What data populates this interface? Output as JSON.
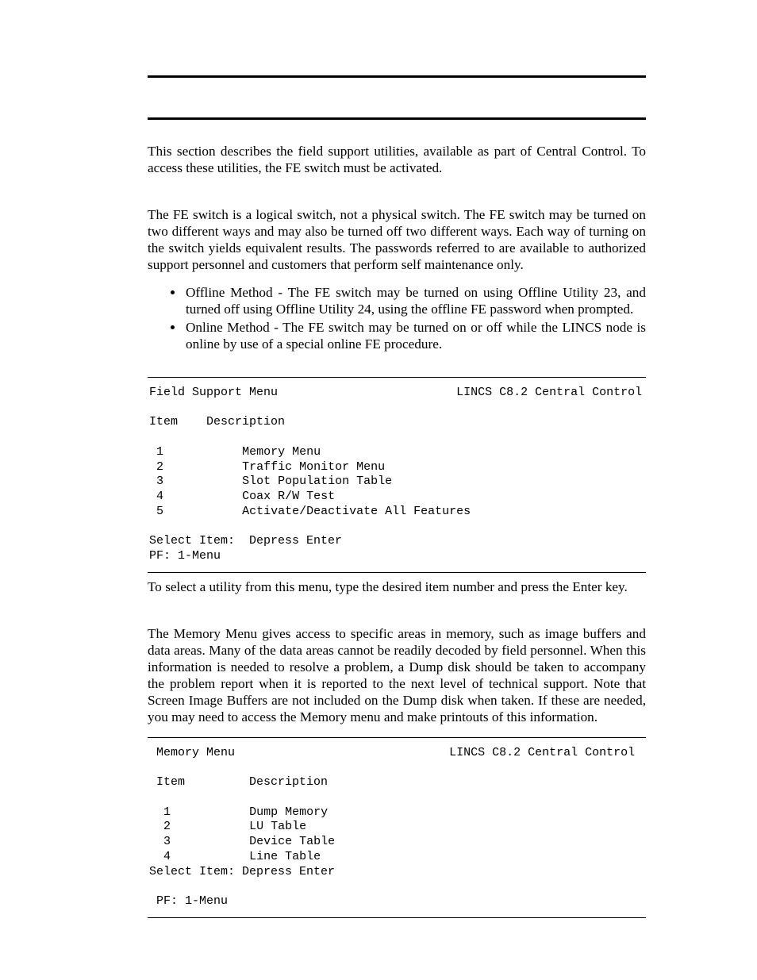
{
  "intro": "This section describes the field support utilities, available as part of Central Control. To access these utilities, the FE switch must be activated.",
  "fe_para": "The FE switch is a logical switch, not a physical switch. The FE switch may be turned on two different ways and may also be turned off two different ways. Each way of turning on the switch yields equivalent results. The passwords referred to are available to authorized support personnel and customers that perform self maintenance only.",
  "bullets": [
    "Offline Method - The FE switch may be turned on using Offline Utility 23, and turned off using Offline Utility 24, using the offline FE password when prompted.",
    "Online Method - The FE switch may be turned on or off while the LINCS node is online by use of a special online FE procedure."
  ],
  "field_menu": {
    "title_left": "Field Support Menu",
    "title_right": "LINCS C8.2 Central Control",
    "col1": "Item",
    "col2": "Description",
    "items": [
      {
        "n": "1",
        "d": "Memory Menu"
      },
      {
        "n": "2",
        "d": "Traffic Monitor Menu"
      },
      {
        "n": "3",
        "d": "Slot Population Table"
      },
      {
        "n": "4",
        "d": "Coax R/W Test"
      },
      {
        "n": "5",
        "d": "Activate/Deactivate All Features"
      }
    ],
    "select": "Select Item:  Depress Enter",
    "pf": "PF: 1-Menu"
  },
  "after_field_menu": "To select a utility from this menu, type the desired item number and press the Enter key.",
  "memory_para": "The Memory Menu gives access to specific areas in memory, such as image buffers and data areas. Many of the data areas cannot be readily decoded by field personnel. When this information is needed to resolve a problem, a Dump disk should be taken to accompany the problem report when it is reported to the next level of technical support. Note that Screen Image Buffers are not included on the Dump disk when taken. If these are needed, you may need to access the Memory menu and make printouts of this information.",
  "memory_menu": {
    "title_left": "Memory Menu",
    "title_right": "LINCS C8.2 Central Control",
    "col1": "Item",
    "col2": "Description",
    "items": [
      {
        "n": "1",
        "d": "Dump Memory"
      },
      {
        "n": "2",
        "d": "LU Table"
      },
      {
        "n": "3",
        "d": "Device Table"
      },
      {
        "n": "4",
        "d": "Line Table"
      }
    ],
    "select": "Select Item: Depress Enter",
    "pf": "PF: 1-Menu"
  }
}
